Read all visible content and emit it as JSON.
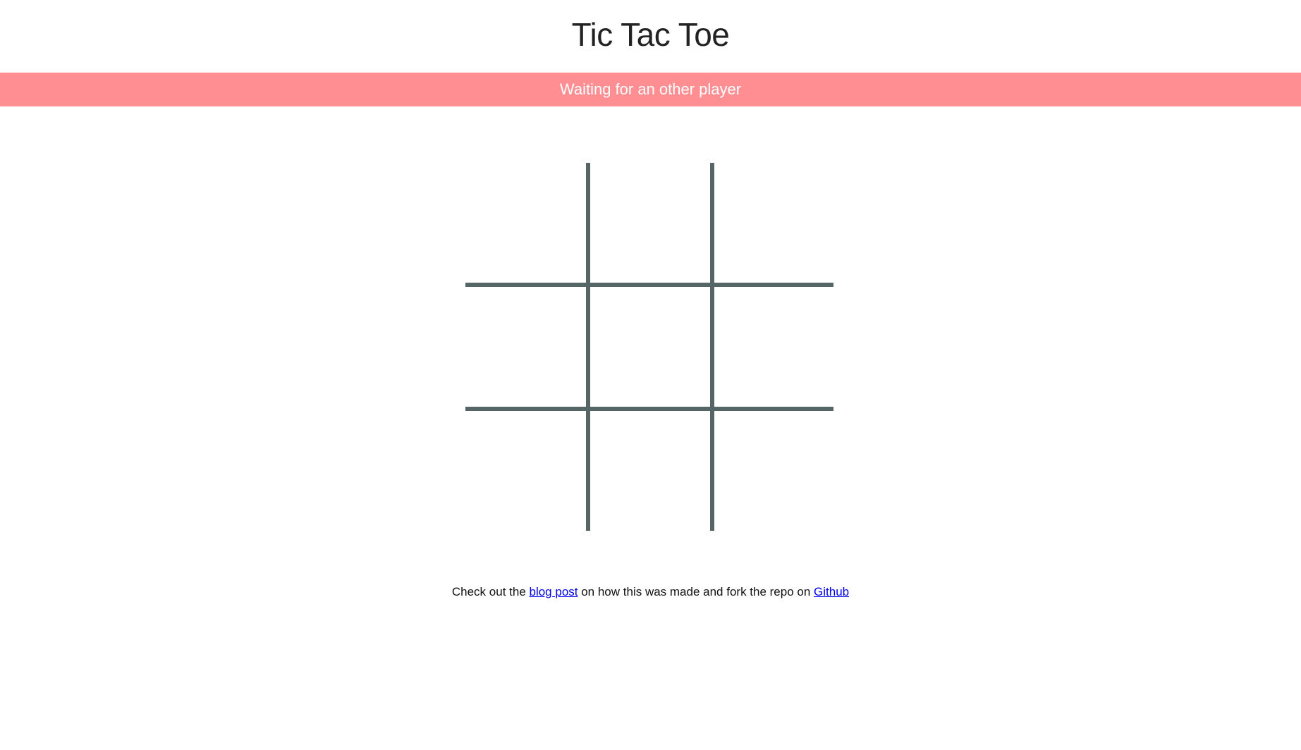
{
  "header": {
    "title": "Tic Tac Toe"
  },
  "status": {
    "message": "Waiting for an other player",
    "color": "#ff8e93"
  },
  "board": {
    "rows": 3,
    "cols": 3,
    "cells": [
      "",
      "",
      "",
      "",
      "",
      "",
      "",
      "",
      ""
    ],
    "line_color": "#566565"
  },
  "footer": {
    "prefix": "Check out the ",
    "blog_link": "blog post",
    "middle": " on how this was made and fork the repo on ",
    "github_link": "Github"
  }
}
